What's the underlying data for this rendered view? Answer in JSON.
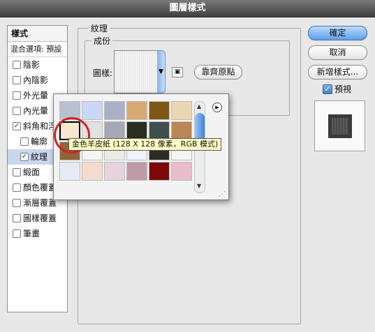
{
  "window": {
    "title": "圖層樣式"
  },
  "sidebar": {
    "header": "樣式",
    "blending": "混合選項: 預設",
    "items": [
      {
        "label": "陰影",
        "checked": false
      },
      {
        "label": "內陰影",
        "checked": false
      },
      {
        "label": "外光暈",
        "checked": false
      },
      {
        "label": "內光暈",
        "checked": false
      },
      {
        "label": "斜角和浮",
        "checked": true
      },
      {
        "label": "輪廓",
        "checked": false
      },
      {
        "label": "紋理",
        "checked": true
      },
      {
        "label": "緞面",
        "checked": false
      },
      {
        "label": "顏色覆蓋",
        "checked": false
      },
      {
        "label": "漸層覆蓋",
        "checked": false
      },
      {
        "label": "圖樣覆蓋",
        "checked": false
      },
      {
        "label": "筆畫",
        "checked": false
      }
    ]
  },
  "panel": {
    "section_title": "紋理",
    "group_title": "成份",
    "pattern_label": "圖樣:",
    "snap_button": "靠齊原點"
  },
  "buttons": {
    "ok": "確定",
    "cancel": "取消",
    "new_style": "新增樣式...",
    "preview": "預視",
    "preview_checked": true
  },
  "picker": {
    "tooltip": "金色羊皮紙 (128 X 128 像素，RGB 模式)",
    "swatch_icons": [
      "scroll-up-icon",
      "scroll-down-icon",
      "menu-arrow-icon",
      "resize-grip-icon"
    ],
    "swatches": [
      [
        "#b7c1cf",
        "#cad8f6",
        "#a9b0c4",
        "#d9a870",
        "#7e5715",
        "#ead7b2"
      ],
      [
        "#f8e6ce",
        "#e1e1e1",
        "#a5a8b5",
        "#2a2e1e",
        "#3f4f4c",
        "#bb8556"
      ],
      [
        "#91643a",
        "#f5f5f5",
        "#ecebe6",
        "#eff2fa",
        "#2c2b25",
        "#f5f5f5"
      ],
      [
        "#e5eaf5",
        "#f4dccd",
        "#e8d2dd",
        "#c19aa8",
        "#7c0808",
        "#e9bccb"
      ]
    ],
    "selected_row": 1,
    "selected_col": 0
  }
}
